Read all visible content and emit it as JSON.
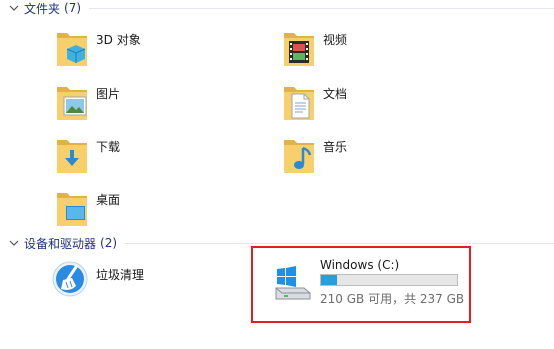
{
  "groups": {
    "folders": {
      "title": "文件夹",
      "count": "(7)"
    },
    "devices": {
      "title": "设备和驱动器",
      "count": "(2)"
    }
  },
  "folders": [
    {
      "label": "3D 对象",
      "icon": "3d-objects-folder-icon"
    },
    {
      "label": "视频",
      "icon": "videos-folder-icon"
    },
    {
      "label": "图片",
      "icon": "pictures-folder-icon"
    },
    {
      "label": "文档",
      "icon": "documents-folder-icon"
    },
    {
      "label": "下载",
      "icon": "downloads-folder-icon"
    },
    {
      "label": "音乐",
      "icon": "music-folder-icon"
    },
    {
      "label": "桌面",
      "icon": "desktop-folder-icon"
    }
  ],
  "devices": {
    "cleanup": {
      "label": "垃圾清理",
      "icon": "broom-cleanup-icon"
    },
    "drive": {
      "name": "Windows (C:)",
      "free_text": "210 GB 可用，共 237 GB",
      "used_fraction": 0.114,
      "icon": "windows-drive-icon"
    }
  },
  "colors": {
    "group_header": "#1e3287",
    "drive_bar_fill": "#26a0da",
    "highlight_box": "#e02020"
  }
}
